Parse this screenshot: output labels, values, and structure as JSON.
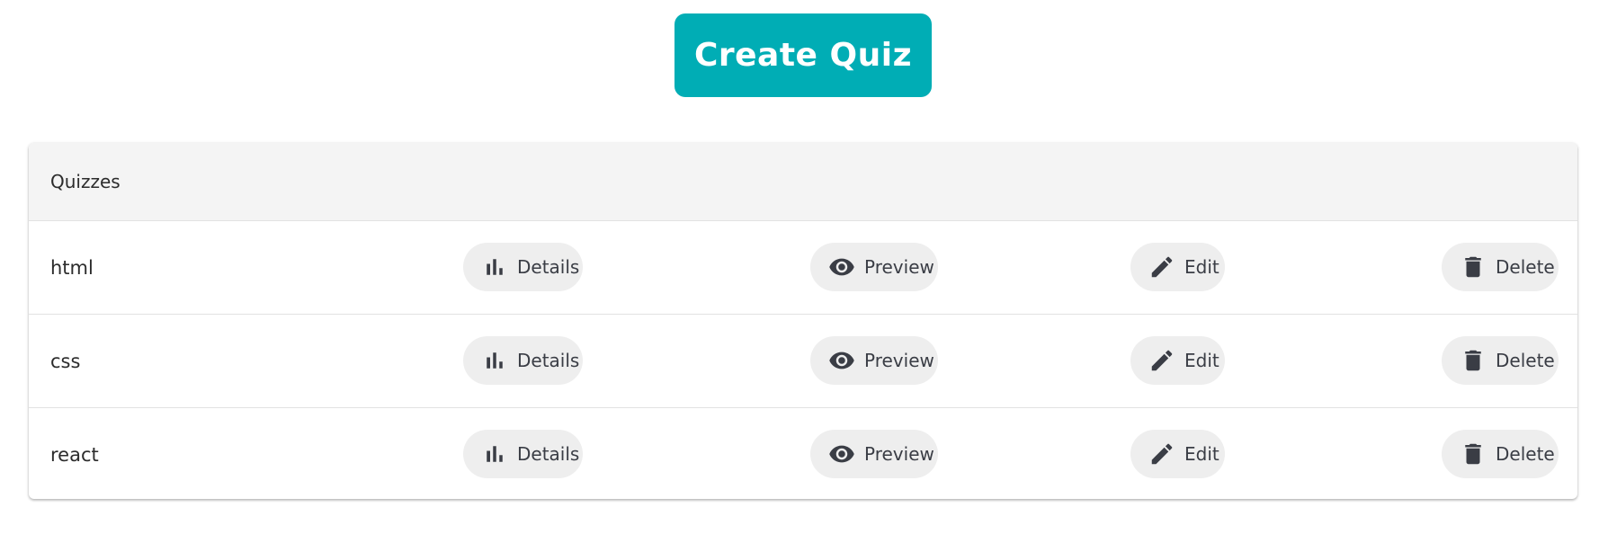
{
  "create_button": {
    "label": "Create Quiz"
  },
  "colors": {
    "accent": "#00adb5",
    "chip_bg": "#eeeeee",
    "icon": "#3a3d45",
    "header_bg": "#f4f4f4"
  },
  "card": {
    "title": "Quizzes"
  },
  "actions": {
    "details": {
      "label": "Details",
      "icon": "bar-chart-icon"
    },
    "preview": {
      "label": "Preview",
      "icon": "eye-icon"
    },
    "edit": {
      "label": "Edit",
      "icon": "pencil-icon"
    },
    "delete": {
      "label": "Delete",
      "icon": "trash-icon"
    }
  },
  "quizzes": [
    {
      "name": "html"
    },
    {
      "name": "css"
    },
    {
      "name": "react"
    }
  ]
}
